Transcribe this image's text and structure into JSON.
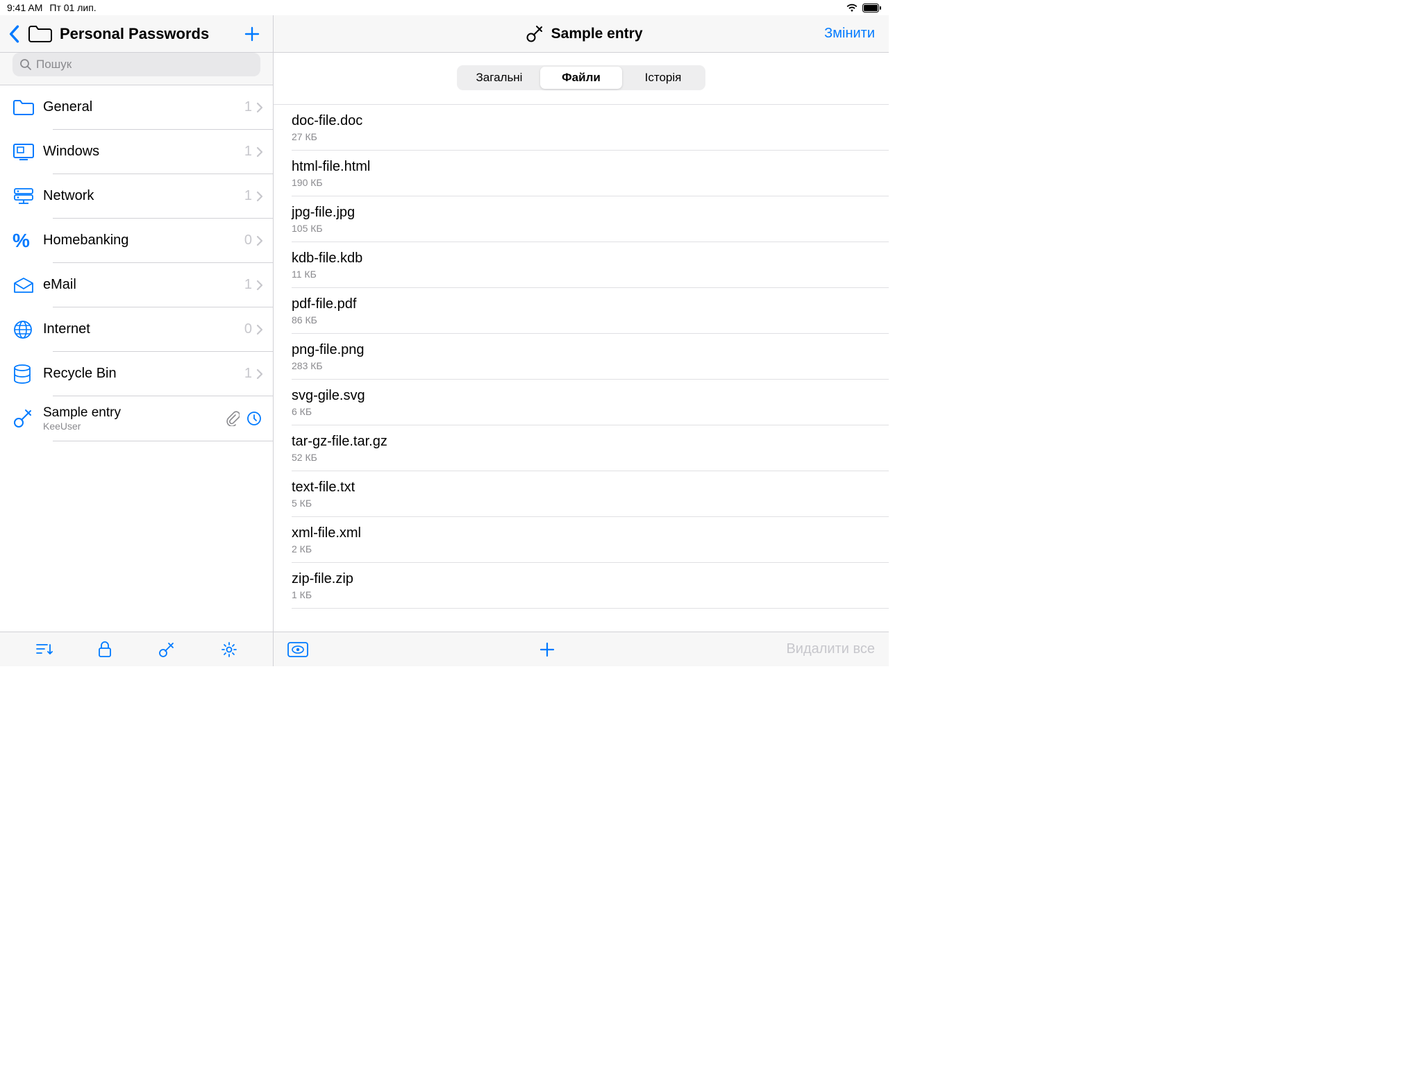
{
  "statusbar": {
    "time": "9:41 AM",
    "date": "Пт 01 лип."
  },
  "sidebar": {
    "title": "Personal Passwords",
    "search_placeholder": "Пошук",
    "folders": [
      {
        "label": "General",
        "count": "1",
        "icon": "folder"
      },
      {
        "label": "Windows",
        "count": "1",
        "icon": "windows"
      },
      {
        "label": "Network",
        "count": "1",
        "icon": "network"
      },
      {
        "label": "Homebanking",
        "count": "0",
        "icon": "percent"
      },
      {
        "label": "eMail",
        "count": "1",
        "icon": "envelope"
      },
      {
        "label": "Internet",
        "count": "0",
        "icon": "globe"
      },
      {
        "label": "Recycle Bin",
        "count": "1",
        "icon": "db"
      }
    ],
    "entry": {
      "title": "Sample entry",
      "subtitle": "KeeUser"
    }
  },
  "detail": {
    "title": "Sample entry",
    "edit": "Змінити",
    "tabs": {
      "general": "Загальні",
      "files": "Файли",
      "history": "Історія"
    },
    "delete_all": "Видалити все",
    "files": [
      {
        "name": "doc-file.doc",
        "size": "27 КБ"
      },
      {
        "name": "html-file.html",
        "size": "190 КБ"
      },
      {
        "name": "jpg-file.jpg",
        "size": "105 КБ"
      },
      {
        "name": "kdb-file.kdb",
        "size": "11 КБ"
      },
      {
        "name": "pdf-file.pdf",
        "size": "86 КБ"
      },
      {
        "name": "png-file.png",
        "size": "283 КБ"
      },
      {
        "name": "svg-gile.svg",
        "size": "6 КБ"
      },
      {
        "name": "tar-gz-file.tar.gz",
        "size": "52 КБ"
      },
      {
        "name": "text-file.txt",
        "size": "5 КБ"
      },
      {
        "name": "xml-file.xml",
        "size": "2 КБ"
      },
      {
        "name": "zip-file.zip",
        "size": "1 КБ"
      }
    ]
  }
}
